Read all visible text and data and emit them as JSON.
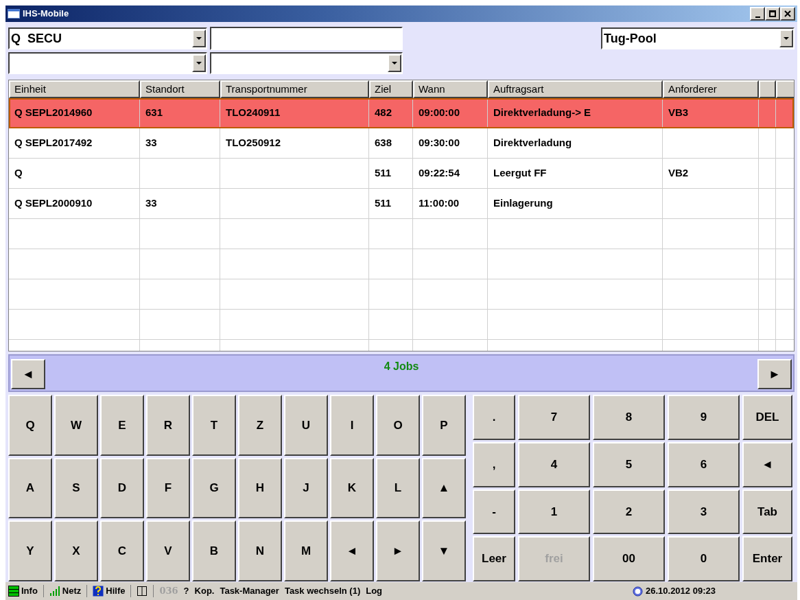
{
  "window": {
    "title": "IHS-Mobile"
  },
  "filters": {
    "unit_combo": {
      "value": "Q  SECU"
    },
    "pool_combo": {
      "value": "Tug-Pool"
    }
  },
  "table": {
    "columns": [
      "Einheit",
      "Standort",
      "Transportnummer",
      "Ziel",
      "Wann",
      "Auftragsart",
      "Anforderer"
    ],
    "rows": [
      {
        "selected": true,
        "einheit": "Q SEPL2014960",
        "standort": "631",
        "transportnummer": "TLO240911",
        "ziel": "482",
        "wann": "09:00:00",
        "auftragsart": "Direktverladung-> E",
        "anforderer": "VB3"
      },
      {
        "selected": false,
        "einheit": "Q SEPL2017492",
        "standort": "33",
        "transportnummer": "TLO250912",
        "ziel": "638",
        "wann": "09:30:00",
        "auftragsart": "Direktverladung"
      },
      {
        "selected": false,
        "einheit": "Q",
        "ziel": "511",
        "wann": "09:22:54",
        "auftragsart": "Leergut FF",
        "anforderer": "VB2"
      },
      {
        "selected": false,
        "einheit": "Q SEPL2000910",
        "standort": "33",
        "ziel": "511",
        "wann": "11:00:00",
        "auftragsart": "Einlagerung"
      }
    ]
  },
  "pager": {
    "prev": "◄",
    "count": "4 Jobs",
    "next": "►"
  },
  "keyboard": {
    "rows": [
      [
        "Q",
        "W",
        "E",
        "R",
        "T",
        "Z",
        "U",
        "I",
        "O",
        "P"
      ],
      [
        "A",
        "S",
        "D",
        "F",
        "G",
        "H",
        "J",
        "K",
        "L",
        "▲"
      ],
      [
        "Y",
        "X",
        "C",
        "V",
        "B",
        "N",
        "M",
        "◄",
        "►",
        "▼"
      ]
    ]
  },
  "numpad": {
    "rows": [
      [
        {
          "label": ".",
          "disabled": false
        },
        {
          "label": "7",
          "disabled": false
        },
        {
          "label": "8",
          "disabled": false
        },
        {
          "label": "9",
          "disabled": false
        },
        {
          "label": "DEL",
          "disabled": false
        }
      ],
      [
        {
          "label": ",",
          "disabled": false
        },
        {
          "label": "4",
          "disabled": false
        },
        {
          "label": "5",
          "disabled": false
        },
        {
          "label": "6",
          "disabled": false
        },
        {
          "label": "◄",
          "disabled": false
        }
      ],
      [
        {
          "label": "-",
          "disabled": false
        },
        {
          "label": "1",
          "disabled": false
        },
        {
          "label": "2",
          "disabled": false
        },
        {
          "label": "3",
          "disabled": false
        },
        {
          "label": "Tab",
          "disabled": false
        }
      ],
      [
        {
          "label": "Leer",
          "disabled": false
        },
        {
          "label": "frei",
          "disabled": true
        },
        {
          "label": "00",
          "disabled": false
        },
        {
          "label": "0",
          "disabled": false
        },
        {
          "label": "Enter",
          "disabled": false
        }
      ]
    ]
  },
  "status_bar": {
    "items": [
      {
        "kind": "info",
        "label": "Info",
        "disabled": false
      },
      {
        "kind": "network",
        "label": "Netz",
        "disabled": false
      },
      {
        "kind": "help",
        "label": "Hilfe",
        "disabled": false
      },
      {
        "kind": "columns"
      },
      {
        "kind": "text",
        "label": "036",
        "disabled": true
      },
      {
        "kind": "text",
        "label": "?",
        "disabled": false
      },
      {
        "kind": "text",
        "label": "Kop.",
        "disabled": false
      },
      {
        "kind": "text",
        "label": "Task-Manager",
        "disabled": false
      },
      {
        "kind": "text",
        "label": "Task wechseln (1)",
        "disabled": false
      },
      {
        "kind": "text",
        "label": "Log",
        "disabled": false
      }
    ],
    "clock": "26.10.2012 09:23"
  }
}
